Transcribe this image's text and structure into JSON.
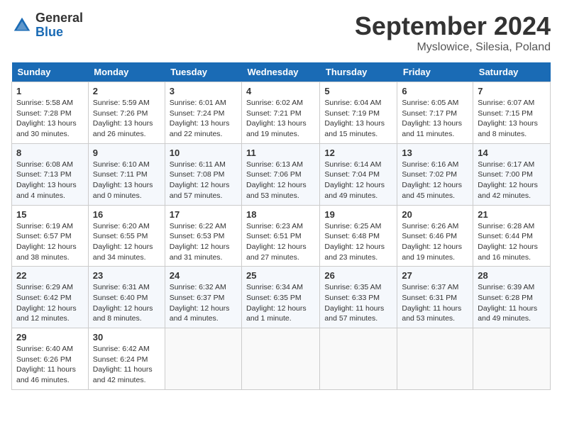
{
  "logo": {
    "general": "General",
    "blue": "Blue"
  },
  "title": "September 2024",
  "location": "Myslowice, Silesia, Poland",
  "days_of_week": [
    "Sunday",
    "Monday",
    "Tuesday",
    "Wednesday",
    "Thursday",
    "Friday",
    "Saturday"
  ],
  "weeks": [
    [
      {
        "day": "1",
        "info": "Sunrise: 5:58 AM\nSunset: 7:28 PM\nDaylight: 13 hours\nand 30 minutes."
      },
      {
        "day": "2",
        "info": "Sunrise: 5:59 AM\nSunset: 7:26 PM\nDaylight: 13 hours\nand 26 minutes."
      },
      {
        "day": "3",
        "info": "Sunrise: 6:01 AM\nSunset: 7:24 PM\nDaylight: 13 hours\nand 22 minutes."
      },
      {
        "day": "4",
        "info": "Sunrise: 6:02 AM\nSunset: 7:21 PM\nDaylight: 13 hours\nand 19 minutes."
      },
      {
        "day": "5",
        "info": "Sunrise: 6:04 AM\nSunset: 7:19 PM\nDaylight: 13 hours\nand 15 minutes."
      },
      {
        "day": "6",
        "info": "Sunrise: 6:05 AM\nSunset: 7:17 PM\nDaylight: 13 hours\nand 11 minutes."
      },
      {
        "day": "7",
        "info": "Sunrise: 6:07 AM\nSunset: 7:15 PM\nDaylight: 13 hours\nand 8 minutes."
      }
    ],
    [
      {
        "day": "8",
        "info": "Sunrise: 6:08 AM\nSunset: 7:13 PM\nDaylight: 13 hours\nand 4 minutes."
      },
      {
        "day": "9",
        "info": "Sunrise: 6:10 AM\nSunset: 7:11 PM\nDaylight: 13 hours\nand 0 minutes."
      },
      {
        "day": "10",
        "info": "Sunrise: 6:11 AM\nSunset: 7:08 PM\nDaylight: 12 hours\nand 57 minutes."
      },
      {
        "day": "11",
        "info": "Sunrise: 6:13 AM\nSunset: 7:06 PM\nDaylight: 12 hours\nand 53 minutes."
      },
      {
        "day": "12",
        "info": "Sunrise: 6:14 AM\nSunset: 7:04 PM\nDaylight: 12 hours\nand 49 minutes."
      },
      {
        "day": "13",
        "info": "Sunrise: 6:16 AM\nSunset: 7:02 PM\nDaylight: 12 hours\nand 45 minutes."
      },
      {
        "day": "14",
        "info": "Sunrise: 6:17 AM\nSunset: 7:00 PM\nDaylight: 12 hours\nand 42 minutes."
      }
    ],
    [
      {
        "day": "15",
        "info": "Sunrise: 6:19 AM\nSunset: 6:57 PM\nDaylight: 12 hours\nand 38 minutes."
      },
      {
        "day": "16",
        "info": "Sunrise: 6:20 AM\nSunset: 6:55 PM\nDaylight: 12 hours\nand 34 minutes."
      },
      {
        "day": "17",
        "info": "Sunrise: 6:22 AM\nSunset: 6:53 PM\nDaylight: 12 hours\nand 31 minutes."
      },
      {
        "day": "18",
        "info": "Sunrise: 6:23 AM\nSunset: 6:51 PM\nDaylight: 12 hours\nand 27 minutes."
      },
      {
        "day": "19",
        "info": "Sunrise: 6:25 AM\nSunset: 6:48 PM\nDaylight: 12 hours\nand 23 minutes."
      },
      {
        "day": "20",
        "info": "Sunrise: 6:26 AM\nSunset: 6:46 PM\nDaylight: 12 hours\nand 19 minutes."
      },
      {
        "day": "21",
        "info": "Sunrise: 6:28 AM\nSunset: 6:44 PM\nDaylight: 12 hours\nand 16 minutes."
      }
    ],
    [
      {
        "day": "22",
        "info": "Sunrise: 6:29 AM\nSunset: 6:42 PM\nDaylight: 12 hours\nand 12 minutes."
      },
      {
        "day": "23",
        "info": "Sunrise: 6:31 AM\nSunset: 6:40 PM\nDaylight: 12 hours\nand 8 minutes."
      },
      {
        "day": "24",
        "info": "Sunrise: 6:32 AM\nSunset: 6:37 PM\nDaylight: 12 hours\nand 4 minutes."
      },
      {
        "day": "25",
        "info": "Sunrise: 6:34 AM\nSunset: 6:35 PM\nDaylight: 12 hours\nand 1 minute."
      },
      {
        "day": "26",
        "info": "Sunrise: 6:35 AM\nSunset: 6:33 PM\nDaylight: 11 hours\nand 57 minutes."
      },
      {
        "day": "27",
        "info": "Sunrise: 6:37 AM\nSunset: 6:31 PM\nDaylight: 11 hours\nand 53 minutes."
      },
      {
        "day": "28",
        "info": "Sunrise: 6:39 AM\nSunset: 6:28 PM\nDaylight: 11 hours\nand 49 minutes."
      }
    ],
    [
      {
        "day": "29",
        "info": "Sunrise: 6:40 AM\nSunset: 6:26 PM\nDaylight: 11 hours\nand 46 minutes."
      },
      {
        "day": "30",
        "info": "Sunrise: 6:42 AM\nSunset: 6:24 PM\nDaylight: 11 hours\nand 42 minutes."
      },
      {
        "day": "",
        "info": ""
      },
      {
        "day": "",
        "info": ""
      },
      {
        "day": "",
        "info": ""
      },
      {
        "day": "",
        "info": ""
      },
      {
        "day": "",
        "info": ""
      }
    ]
  ]
}
